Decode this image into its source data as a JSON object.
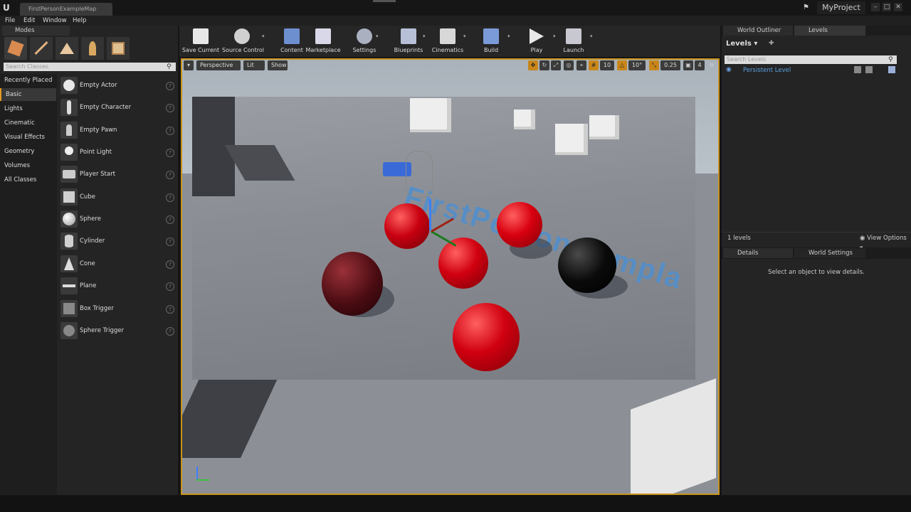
{
  "window": {
    "map_tab": "FirstPersonExampleMap",
    "project_name": "MyProject",
    "buttons": [
      "–",
      "□",
      "✕"
    ]
  },
  "menu": [
    "File",
    "Edit",
    "Window",
    "Help"
  ],
  "modes": {
    "tab_label": "Modes",
    "search_placeholder": "Search Classes",
    "categories": [
      "Recently Placed",
      "Basic",
      "Lights",
      "Cinematic",
      "Visual Effects",
      "Geometry",
      "Volumes",
      "All Classes"
    ],
    "selected_category": "Basic",
    "classes": [
      "Empty Actor",
      "Empty Character",
      "Empty Pawn",
      "Point Light",
      "Player Start",
      "Cube",
      "Sphere",
      "Cylinder",
      "Cone",
      "Plane",
      "Box Trigger",
      "Sphere Trigger"
    ]
  },
  "toolbar": {
    "buttons": [
      "Save Current",
      "Source Control",
      "Content",
      "Marketplace",
      "Settings",
      "Blueprints",
      "Cinematics",
      "Build",
      "Play",
      "Launch"
    ]
  },
  "viewport": {
    "perspective": "Perspective",
    "lit": "Lit",
    "show": "Show",
    "grid_snap": "10",
    "rotation_snap": "10°",
    "scale_snap": "0.25",
    "camera_speed": "4",
    "floor_text": "FirstPerson Templa",
    "active_border_color": "#c9941d"
  },
  "outliner": {
    "tab_world_outliner": "World Outliner",
    "tab_levels": "Levels",
    "levels_header": "Levels",
    "search_placeholder": "Search Levels",
    "persistent_level": "Persistent Level",
    "level_count": "1 levels",
    "view_options": "View Options"
  },
  "details": {
    "tab_details": "Details",
    "tab_world_settings": "World Settings",
    "empty_message": "Select an object to view details."
  },
  "colors": {
    "accent": "#c9941d",
    "level_link": "#5aa0e0"
  }
}
